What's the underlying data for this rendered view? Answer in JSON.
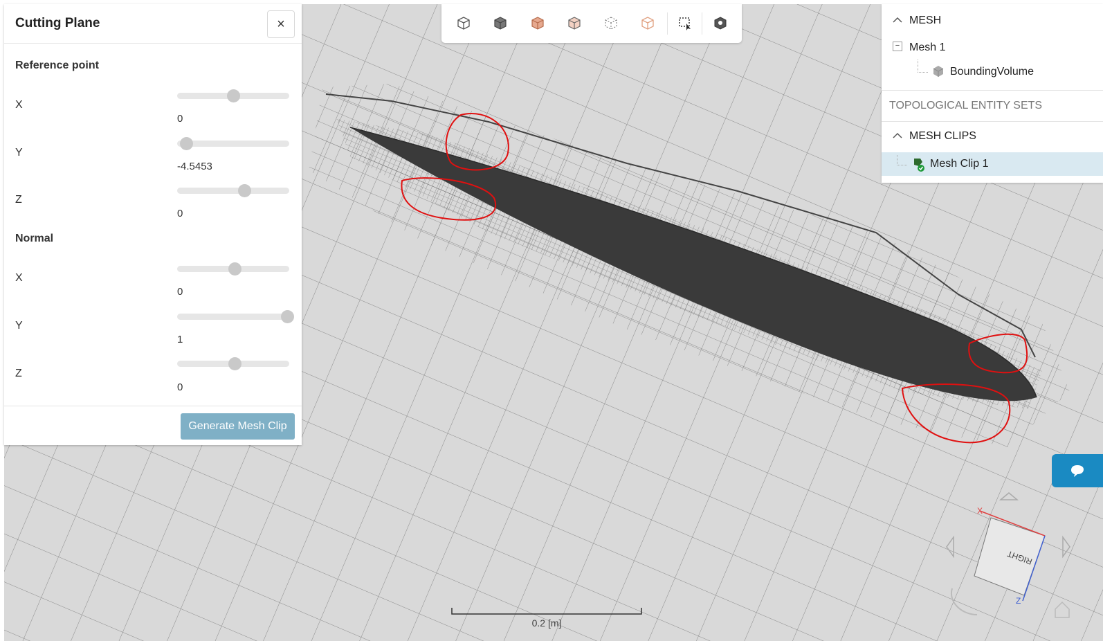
{
  "panel": {
    "title": "Cutting Plane",
    "close_icon": "×",
    "reference_label": "Reference point",
    "reference": [
      {
        "axis": "X",
        "value": "0",
        "slider_fraction": 0.5
      },
      {
        "axis": "Y",
        "value": "-4.5453",
        "slider_fraction": 0.08
      },
      {
        "axis": "Z",
        "value": "0",
        "slider_fraction": 0.6
      }
    ],
    "normal_label": "Normal",
    "normal": [
      {
        "axis": "X",
        "value": "0",
        "slider_fraction": 0.51
      },
      {
        "axis": "Y",
        "value": "1",
        "slider_fraction": 0.98
      },
      {
        "axis": "Z",
        "value": "0",
        "slider_fraction": 0.51
      }
    ],
    "generate_button": "Generate Mesh Clip"
  },
  "toolbar": {
    "icons": [
      "cube-outline-icon",
      "cube-solid-icon",
      "cube-shaded-orange-icon",
      "cube-wire-orange-icon",
      "cube-points-icon",
      "cube-transparent-orange-icon",
      "box-select-icon",
      "mesh-settings-icon"
    ]
  },
  "tree": {
    "mesh_header": "MESH",
    "mesh_item": "Mesh 1",
    "mesh_child": "BoundingVolume",
    "topo_header": "TOPOLOGICAL ENTITY SETS",
    "clips_header": "MESH CLIPS",
    "clip_item": "Mesh Clip 1"
  },
  "viewport": {
    "scale_label": "0.2 [m]",
    "orientation_face": "RIGHT",
    "axis_x": "X",
    "axis_z": "Z"
  },
  "colors": {
    "accent": "#1a8ac2",
    "button": "#7fb0c6",
    "selection": "#d9e9f1",
    "annotation": "#e01010"
  }
}
